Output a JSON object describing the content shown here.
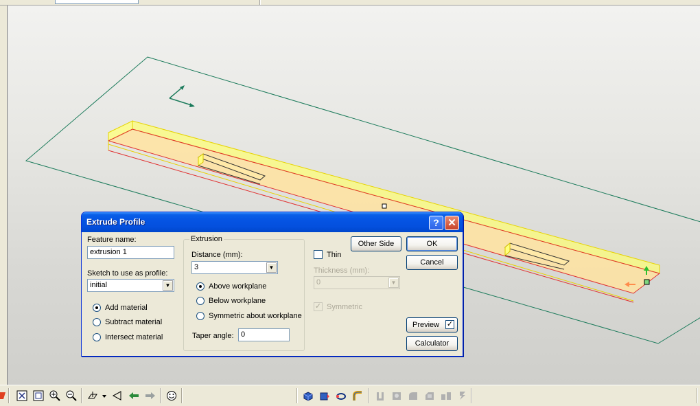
{
  "dialog": {
    "title": "Extrude Profile",
    "help_glyph": "?",
    "close_glyph": "✕",
    "feature_name_label": "Feature name:",
    "feature_name_value": "extrusion 1",
    "sketch_label": "Sketch to use as profile:",
    "sketch_value": "initial",
    "material_options": [
      "Add material",
      "Subtract material",
      "Intersect material"
    ],
    "material_selected": "Add material",
    "extrusion_group_label": "Extrusion",
    "distance_label": "Distance (mm):",
    "distance_value": "3",
    "direction_options": [
      "Above workplane",
      "Below workplane",
      "Symmetric about workplane"
    ],
    "direction_selected": "Above workplane",
    "taper_label": "Taper angle:",
    "taper_value": "0",
    "thin_label": "Thin",
    "thin_checked": false,
    "thickness_label": "Thickness (mm):",
    "thickness_value": "0",
    "symmetric_label": "Symmetric",
    "symmetric_checked": true,
    "other_side_label": "Other Side",
    "ok_label": "OK",
    "cancel_label": "Cancel",
    "preview_label": "Preview",
    "preview_checked": true,
    "calculator_label": "Calculator",
    "check_glyph": "✓",
    "combo_arrow_glyph": "▼"
  },
  "toolbar": {
    "icons": [
      "zoom-extents-icon",
      "zoom-window-icon",
      "zoom-in-icon",
      "zoom-out-icon",
      "view-orientation-icon",
      "dropdown-arrow-icon",
      "previous-view-icon",
      "back-arrow-icon",
      "forward-arrow-icon",
      "smiley-icon",
      "extrude-icon",
      "revolve-icon",
      "sweep-icon",
      "loft-icon",
      "shell-icon",
      "hole-icon",
      "fillet-icon",
      "chamfer-icon",
      "pattern-icon",
      "mirror-icon"
    ]
  },
  "colors": {
    "viewport_top": "#f2f2f0",
    "viewport_bottom": "#cfcfcb",
    "workplane": "#1a7a5a",
    "part_fill": "#ffe9a8",
    "part_edge": "#e03030",
    "part_highlight": "#ffff66",
    "title_bar": "#0554e3"
  }
}
